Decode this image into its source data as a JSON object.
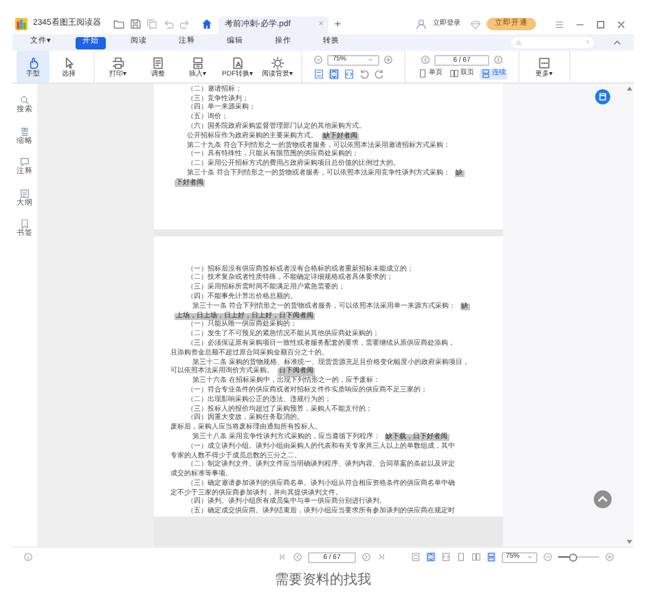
{
  "app": {
    "name": "2345看图王阅读器"
  },
  "tab": {
    "title": "考前冲刺-必学.pdf",
    "close": "×"
  },
  "new_tab": "+",
  "account": {
    "login": "立即登录",
    "upgrade": "立即开通"
  },
  "menu": [
    {
      "label": "文件▾",
      "selected": false
    },
    {
      "label": "开始",
      "selected": true
    },
    {
      "label": "阅读",
      "selected": false
    },
    {
      "label": "注释",
      "selected": false
    },
    {
      "label": "编辑",
      "selected": false
    },
    {
      "label": "操作",
      "selected": false
    },
    {
      "label": "转换",
      "selected": false
    }
  ],
  "search": {
    "clear": "×"
  },
  "tools": [
    {
      "label": "手型",
      "selected": true
    },
    {
      "label": "选择",
      "selected": false
    }
  ],
  "actions": [
    "打印▾",
    "调整",
    "插入▾",
    "PDF转换▾",
    "阅读背景▾"
  ],
  "zoom": {
    "value": "75%"
  },
  "fit_modes": [
    {
      "selected": false
    },
    {
      "selected": true
    },
    {
      "selected": false
    }
  ],
  "page_nav": {
    "value": "6 / 67"
  },
  "page_modes": [
    {
      "label": "单页",
      "selected": false
    },
    {
      "label": "双页",
      "selected": false
    },
    {
      "label": "连续",
      "selected": true
    }
  ],
  "more": "更多▾",
  "side_panel": [
    "搜索",
    "缩略",
    "注释",
    "大纲",
    "书签"
  ],
  "pages": [
    {
      "lines": [
        {
          "kind": "item",
          "text": "（二）邀请招标；"
        },
        {
          "kind": "item",
          "text": "（三）竞争性谈判；"
        },
        {
          "kind": "item",
          "text": "（四）单一来源采购；"
        },
        {
          "kind": "item",
          "text": "（五）询价；"
        },
        {
          "kind": "item",
          "text": "（六）国务院政府采购监督管理部门认定的其他采购方式。"
        },
        {
          "kind": "item",
          "text": "公开招标应作为政府采购的主要采购方式。",
          "highlight": "缺下好者阅"
        },
        {
          "kind": "item",
          "text": "第二十九条 符合下列情形之一的货物或者服务，可以依照本法采用邀请招标方式采购："
        },
        {
          "kind": "item",
          "text": "（一）具有特殊性，只能从有限范围的供应商处采购的；"
        },
        {
          "kind": "item",
          "text": "（二）采用公开招标方式的费用占政府采购项目总价值的比例过大的。"
        },
        {
          "kind": "item",
          "text": "第三十条 符合下列情形之一的货物或者服务，可以依照本法采用竞争性谈判方式采购：",
          "highlight": "缺"
        },
        {
          "kind": "plain",
          "highlight": "下好者阅"
        }
      ]
    },
    {
      "lines": [
        {
          "kind": "item",
          "text": "（一）招标后没有供应商投标或者没有合格标的或者重新招标未能成立的；"
        },
        {
          "kind": "item",
          "text": "（二）技术复杂或者性质特殊，不能确定详细规格或者具体要求的；"
        },
        {
          "kind": "item",
          "text": "（三）采用招标所需时间不能满足用户紧急需要的；"
        },
        {
          "kind": "item",
          "text": "（四）不能事先计算出价格总额的。"
        },
        {
          "kind": "article",
          "text": "第三十一条 符合下列情形之一的货物或者服务，可以依照本法采用单一来源方式采购：",
          "highlight": "缺"
        },
        {
          "kind": "plain",
          "highlight": "上场，日上场，日上好，日上好，日下阅者阅"
        },
        {
          "kind": "item",
          "text": "（一）只能从唯一供应商处采购的；"
        },
        {
          "kind": "item",
          "text": "（二）发生了不可预见的紧急情况不能从其他供应商处采购的；"
        },
        {
          "kind": "item",
          "text": "（三）必须保证原有采购项目一致性或者服务配套的要求，需要继续从原供应商处添购，"
        },
        {
          "kind": "plain",
          "text": "且添购资金总额不超过原合同采购金额百分之十的。"
        },
        {
          "kind": "article",
          "text": "第三十二条 采购的货物规格、标准统一、现货货源充足且价格变化幅度小的政府采购项目，"
        },
        {
          "kind": "plain",
          "text": "可以依照本法采用询价方式采购。",
          "highlight": "日下阅者阅"
        },
        {
          "kind": "article",
          "text": "第三十六条 在招标采购中，出现下列情形之一的，应予废标："
        },
        {
          "kind": "item",
          "text": "（一）符合专业条件的供应商或者对招标文件作实质响应的供应商不足三家的；"
        },
        {
          "kind": "item",
          "text": "（二）出现影响采购公正的违法、违规行为的；"
        },
        {
          "kind": "item",
          "text": "（三）投标人的报价均超过了采购预算，采购人不能支付的；"
        },
        {
          "kind": "item",
          "text": "（四）因重大变故，采购任务取消的。"
        },
        {
          "kind": "plain",
          "text": "废标后，采购人应当将废标理由通知所有投标人。"
        },
        {
          "kind": "article",
          "text": "第三十八条 采用竞争性谈判方式采购的，应当遵循下列程序：",
          "highlight": "缺下载，日下好者阅"
        },
        {
          "kind": "item",
          "text": "（一）成立谈判小组。谈判小组由采购人的代表和有关专家共三人以上的单数组成，其中"
        },
        {
          "kind": "plain",
          "text": "专家的人数不得少于成员总数的三分之二。"
        },
        {
          "kind": "item",
          "text": "（二）制定谈判文件。谈判文件应当明确谈判程序、谈判内容、合同草案的条款以及评定"
        },
        {
          "kind": "plain",
          "text": "成交的标准等事项。"
        },
        {
          "kind": "item",
          "text": "（三）确定邀请参加谈判的供应商名单。谈判小组从符合相应资格条件的供应商名单中确"
        },
        {
          "kind": "plain",
          "text": "定不少于三家的供应商参加谈判，并向其提供谈判文件。"
        },
        {
          "kind": "item",
          "text": "（四）谈判。谈判小组所有成员集中与单一供应商分别进行谈判。"
        },
        {
          "kind": "item",
          "text": "（五）确定成交供应商。谈判结束后，谈判小组应当要求所有参加谈判的供应商在规定时"
        }
      ]
    }
  ],
  "status_bar": {
    "page": "6 / 67",
    "zoom": "75%",
    "fit_modes": [
      {
        "selected": false
      },
      {
        "selected": true
      },
      {
        "selected": false
      }
    ],
    "page_modes": [
      {
        "selected": false
      },
      {
        "selected": false
      },
      {
        "selected": true
      }
    ],
    "zoom_slider": {
      "level": 0.35
    }
  },
  "caption": "需要资料的找我"
}
